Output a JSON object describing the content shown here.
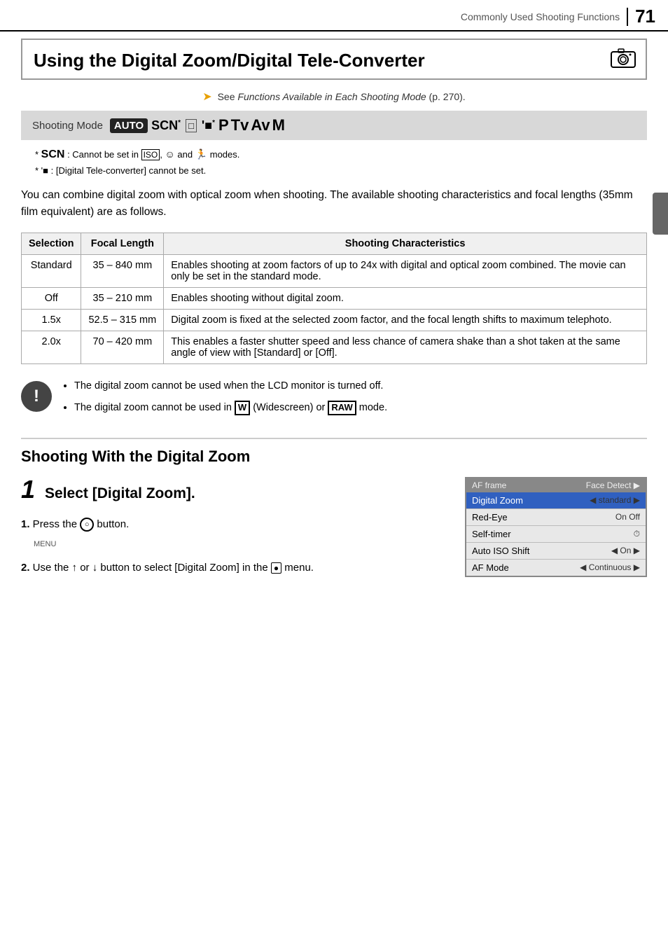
{
  "header": {
    "label": "Commonly Used Shooting Functions",
    "page_number": "71"
  },
  "title": {
    "text": "Using the Digital Zoom/Digital Tele-Converter",
    "camera_icon": "camera-icon"
  },
  "see_note": {
    "prefix": "See ",
    "italic_text": "Functions Available in Each Shooting Mode",
    "suffix": " (p. 270)."
  },
  "shooting_mode": {
    "label": "Shooting Mode",
    "modes": [
      "AUTO",
      "SCN*",
      "□",
      "'■*",
      "P",
      "Tv",
      "Av",
      "M"
    ]
  },
  "footnotes": [
    "* SCN : Cannot be set in  🔲 ,  ☆  and  🏃  modes.",
    "* '■ : [Digital Tele-converter] cannot be set."
  ],
  "intro_text": "You can combine digital zoom with optical zoom when shooting. The available shooting characteristics and focal lengths (35mm film equivalent) are as follows.",
  "table": {
    "headers": [
      "Selection",
      "Focal Length",
      "Shooting Characteristics"
    ],
    "rows": [
      {
        "selection": "Standard",
        "focal_length": "35 – 840 mm",
        "characteristics": "Enables shooting at zoom factors of up to 24x with digital and optical zoom combined. The movie can only be set in the standard mode."
      },
      {
        "selection": "Off",
        "focal_length": "35 – 210 mm",
        "characteristics": "Enables shooting without digital zoom."
      },
      {
        "selection": "1.5x",
        "focal_length": "52.5 – 315 mm",
        "characteristics": "Digital zoom is fixed at the selected zoom factor, and the focal length shifts to maximum telephoto."
      },
      {
        "selection": "2.0x",
        "focal_length": "70 – 420 mm",
        "characteristics": "This enables a faster shutter speed and less chance of camera shake than a shot taken at the same angle of view with [Standard] or [Off]."
      }
    ]
  },
  "notes": [
    "The digital zoom cannot be used when the LCD monitor is turned off.",
    "The digital zoom cannot be used in  W  (Widescreen) or  RAW  mode."
  ],
  "section_heading": "Shooting With the Digital Zoom",
  "step": {
    "number": "1",
    "title": "Select [Digital Zoom].",
    "instructions": [
      {
        "num": "1.",
        "text": "Press the  ○  button."
      },
      {
        "num": "2.",
        "text": "Use the  ↑  or  ↓  button to select [Digital Zoom] in the  🔲  menu."
      }
    ]
  },
  "camera_screen": {
    "header_left": "AF frame",
    "header_right": "Face Detect ▶",
    "rows": [
      {
        "label": "Digital Zoom",
        "value": "◀ standard ▶",
        "highlighted": true
      },
      {
        "label": "Red-Eye",
        "value": "On Off"
      },
      {
        "label": "Self-timer",
        "value": "⏱"
      },
      {
        "label": "Auto ISO Shift",
        "value": "◀ On ▶"
      },
      {
        "label": "AF Mode",
        "value": "◀ Continuous ▶"
      }
    ]
  },
  "or_text": "or"
}
